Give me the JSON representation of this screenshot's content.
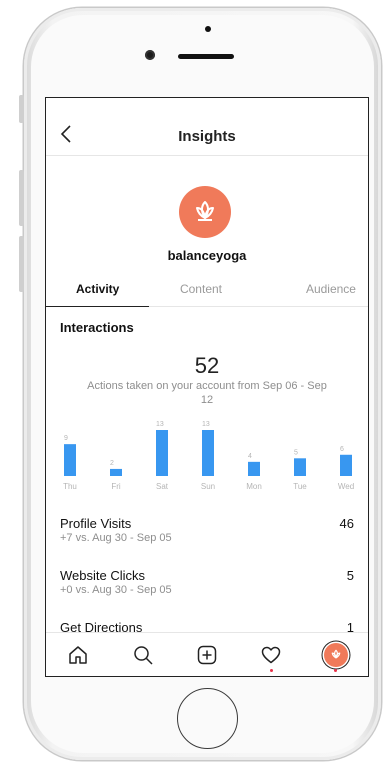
{
  "header": {
    "title": "Insights"
  },
  "profile": {
    "username": "balanceyoga"
  },
  "tabs": [
    {
      "label": "Activity",
      "active": true
    },
    {
      "label": "Content",
      "active": false
    },
    {
      "label": "Audience",
      "active": false
    }
  ],
  "interactions": {
    "title": "Interactions",
    "total": "52",
    "subtitle": "Actions taken on your account from Sep 06 - Sep 12"
  },
  "chart_data": {
    "type": "bar",
    "categories": [
      "Thu",
      "Fri",
      "Sat",
      "Sun",
      "Mon",
      "Tue",
      "Wed"
    ],
    "values": [
      9,
      2,
      13,
      13,
      4,
      5,
      6
    ],
    "ylim": [
      0,
      13
    ],
    "bar_color": "#3897f0",
    "label_color": "#b5b5b5"
  },
  "metrics": [
    {
      "label": "Profile Visits",
      "sub": "+7 vs. Aug 30 - Sep 05",
      "value": "46"
    },
    {
      "label": "Website Clicks",
      "sub": "+0 vs. Aug 30 - Sep 05",
      "value": "5"
    },
    {
      "label": "Get Directions",
      "sub": "",
      "value": "1"
    }
  ],
  "nav": {
    "items": [
      "home-icon",
      "search-icon",
      "add-icon",
      "heart-icon",
      "profile-icon"
    ]
  },
  "colors": {
    "accent": "#f07a5a",
    "notification": "#e8334a"
  }
}
